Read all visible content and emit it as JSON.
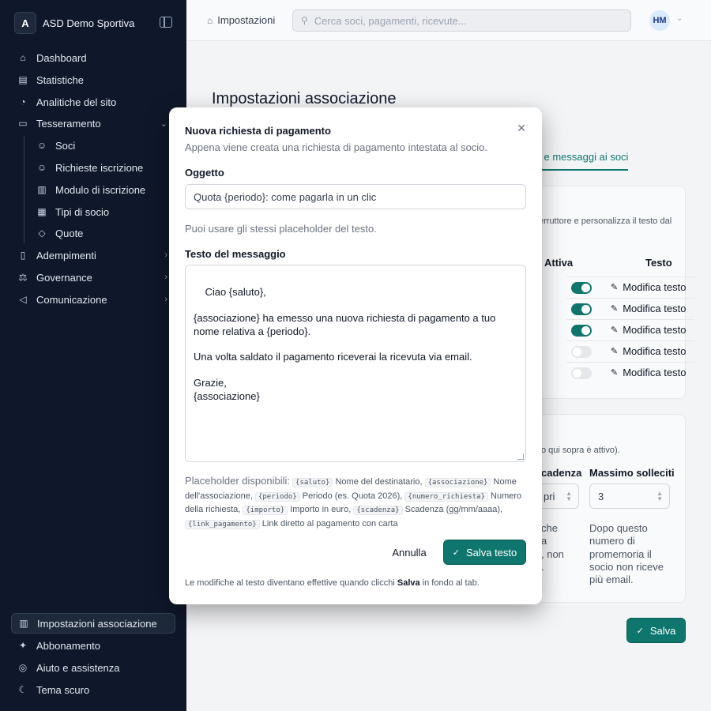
{
  "sidebar": {
    "brand_initial": "A",
    "brand_name": "ASD Demo Sportiva",
    "items": [
      {
        "label": "Dashboard"
      },
      {
        "label": "Statistiche"
      },
      {
        "label": "Analitiche del sito"
      },
      {
        "label": "Tesseramento"
      },
      {
        "label": "Soci"
      },
      {
        "label": "Richieste iscrizione"
      },
      {
        "label": "Modulo di iscrizione"
      },
      {
        "label": "Tipi di socio"
      },
      {
        "label": "Quote"
      },
      {
        "label": "Adempimenti"
      },
      {
        "label": "Governance"
      },
      {
        "label": "Comunicazione"
      }
    ],
    "bottom": [
      {
        "label": "Impostazioni associazione"
      },
      {
        "label": "Abbonamento"
      },
      {
        "label": "Aiuto e assistenza"
      },
      {
        "label": "Tema scuro"
      }
    ]
  },
  "topbar": {
    "breadcrumb": "Impostazioni",
    "search_placeholder": "Cerca soci, pagamenti, ricevute...",
    "avatar_initials": "HM"
  },
  "main": {
    "title": "Impostazioni associazione",
    "active_tab": "l e messaggi ai soci",
    "card1_desc": "erruttore e personalizza il testo dal",
    "col_active": "Attiva",
    "col_text": "Testo",
    "rows": [
      {
        "active": true,
        "edit_label": "Modifica testo"
      },
      {
        "active": true,
        "edit_label": "Modifica testo"
      },
      {
        "active": true,
        "edit_label": "Modifica testo"
      },
      {
        "active": false,
        "edit_label": "Modifica testo"
      },
      {
        "active": false,
        "edit_label": "Modifica testo"
      }
    ],
    "card2_desc": "o qui sopra è attivo).",
    "col_cadenza": "cadenza",
    "cadenza_value": "pri",
    "col_max": "Massimo solleciti",
    "max_value": "3",
    "cadenza_help_lines": [
      "che",
      "a",
      ", non",
      "."
    ],
    "max_help": "Dopo questo numero di promemoria il socio non riceve più email.",
    "save_label": "Salva"
  },
  "modal": {
    "title": "Nuova richiesta di pagamento",
    "subtitle": "Appena viene creata una richiesta di pagamento intestata al socio.",
    "subject_label": "Oggetto",
    "subject_value": "Quota {periodo}: come pagarla in un clic",
    "subject_hint": "Puoi usare gli stessi placeholder del testo.",
    "body_label": "Testo del messaggio",
    "body_value": "Ciao {saluto},\n\n{associazione} ha emesso una nuova richiesta di pagamento a tuo nome relativa a {periodo}.\n\nUna volta saldato il pagamento riceverai la ricevuta via email.\n\nGrazie,\n{associazione}",
    "placeholders_label": "Placeholder disponibili:",
    "placeholders": [
      {
        "code": "{saluto}",
        "desc": "Nome del destinatario,"
      },
      {
        "code": "{associazione}",
        "desc": "Nome dell'associazione,"
      },
      {
        "code": "{periodo}",
        "desc": "Periodo (es. Quota 2026),"
      },
      {
        "code": "{numero_richiesta}",
        "desc": "Numero della richiesta,"
      },
      {
        "code": "{importo}",
        "desc": "Importo in euro,"
      },
      {
        "code": "{scadenza}",
        "desc": "Scadenza (gg/mm/aaaa),"
      },
      {
        "code": "{link_pagamento}",
        "desc": "Link diretto al pagamento con carta"
      }
    ],
    "cancel_label": "Annulla",
    "save_label": "Salva testo",
    "footer_before": "Le modifiche al testo diventano effettive quando clicchi ",
    "footer_bold": "Salva",
    "footer_after": " in fondo al tab."
  },
  "colors": {
    "accent": "#0f766e",
    "sidebar_bg": "#0f172a"
  }
}
